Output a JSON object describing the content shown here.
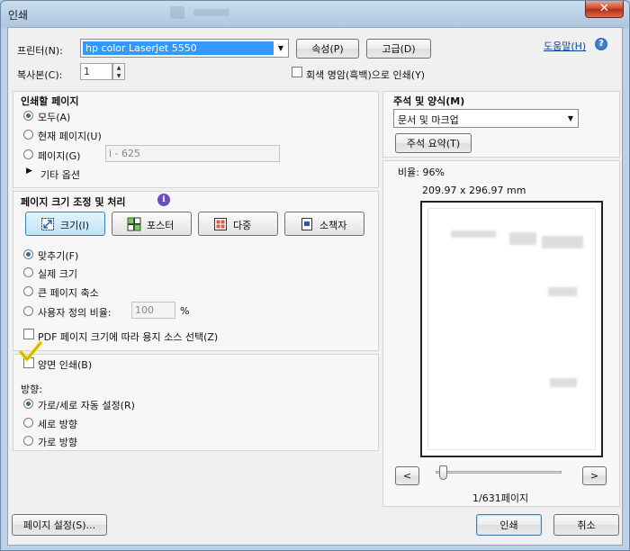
{
  "window": {
    "title": "인쇄",
    "close_glyph": "✕"
  },
  "header": {
    "printer_label": "프린터(N):",
    "printer_value": "hp color LaserJet 5550",
    "properties_button": "속성(P)",
    "advanced_button": "고급(D)",
    "help_link": "도움말(H)",
    "copies_label": "복사본(C):",
    "copies_value": "1",
    "grayscale_label": "회색 명암(흑백)으로 인쇄(Y)"
  },
  "pages_to_print": {
    "title": "인쇄할 페이지",
    "options": [
      {
        "label": "모두(A)",
        "checked": true
      },
      {
        "label": "현재 페이지(U)",
        "checked": false
      },
      {
        "label": "페이지(G)",
        "checked": false
      }
    ],
    "page_range_placeholder": "i - 625",
    "more_options": "기타 옵션"
  },
  "sizing": {
    "title": "페이지 크기 조정 및 처리",
    "info_glyph": "i",
    "modes": [
      {
        "label": "크기(I)",
        "selected": true,
        "icon": "resize-icon"
      },
      {
        "label": "포스터",
        "selected": false,
        "icon": "poster-icon"
      },
      {
        "label": "다중",
        "selected": false,
        "icon": "multiple-pages-icon"
      },
      {
        "label": "소책자",
        "selected": false,
        "icon": "booklet-icon"
      }
    ],
    "fit_options": [
      {
        "label": "맞추기(F)",
        "checked": true
      },
      {
        "label": "실제 크기",
        "checked": false
      },
      {
        "label": "큰 페이지 축소",
        "checked": false
      },
      {
        "label": "사용자 정의 비율:",
        "checked": false
      }
    ],
    "custom_scale_value": "100",
    "percent_symbol": "%",
    "pdf_paper_source_label": "PDF 페이지 크기에 따라 용지 소스 선택(Z)"
  },
  "duplex": {
    "label": "양면 인쇄(B)",
    "checked": true
  },
  "orientation": {
    "title": "방향:",
    "options": [
      {
        "label": "가로/세로 자동 설정(R)",
        "checked": true
      },
      {
        "label": "세로 방향",
        "checked": false
      },
      {
        "label": "가로 방향",
        "checked": false
      }
    ]
  },
  "comments_forms": {
    "title": "주석 및 양식(M)",
    "value": "문서 및 마크업",
    "summarize_button": "주석 요약(T)"
  },
  "preview": {
    "scale_text": "비율: 96%",
    "size_text": "209.97 x 296.97 mm",
    "prev_glyph": "<",
    "next_glyph": ">",
    "page_counter": "1/631페이지",
    "current_page": 1,
    "total_pages": 631
  },
  "footer": {
    "page_setup_button": "페이지 설정(S)...",
    "print_button": "인쇄",
    "cancel_button": "취소"
  },
  "colors": {
    "accent": "#3399ff",
    "link": "#0645ad",
    "check_mark": "#f2d20a"
  }
}
